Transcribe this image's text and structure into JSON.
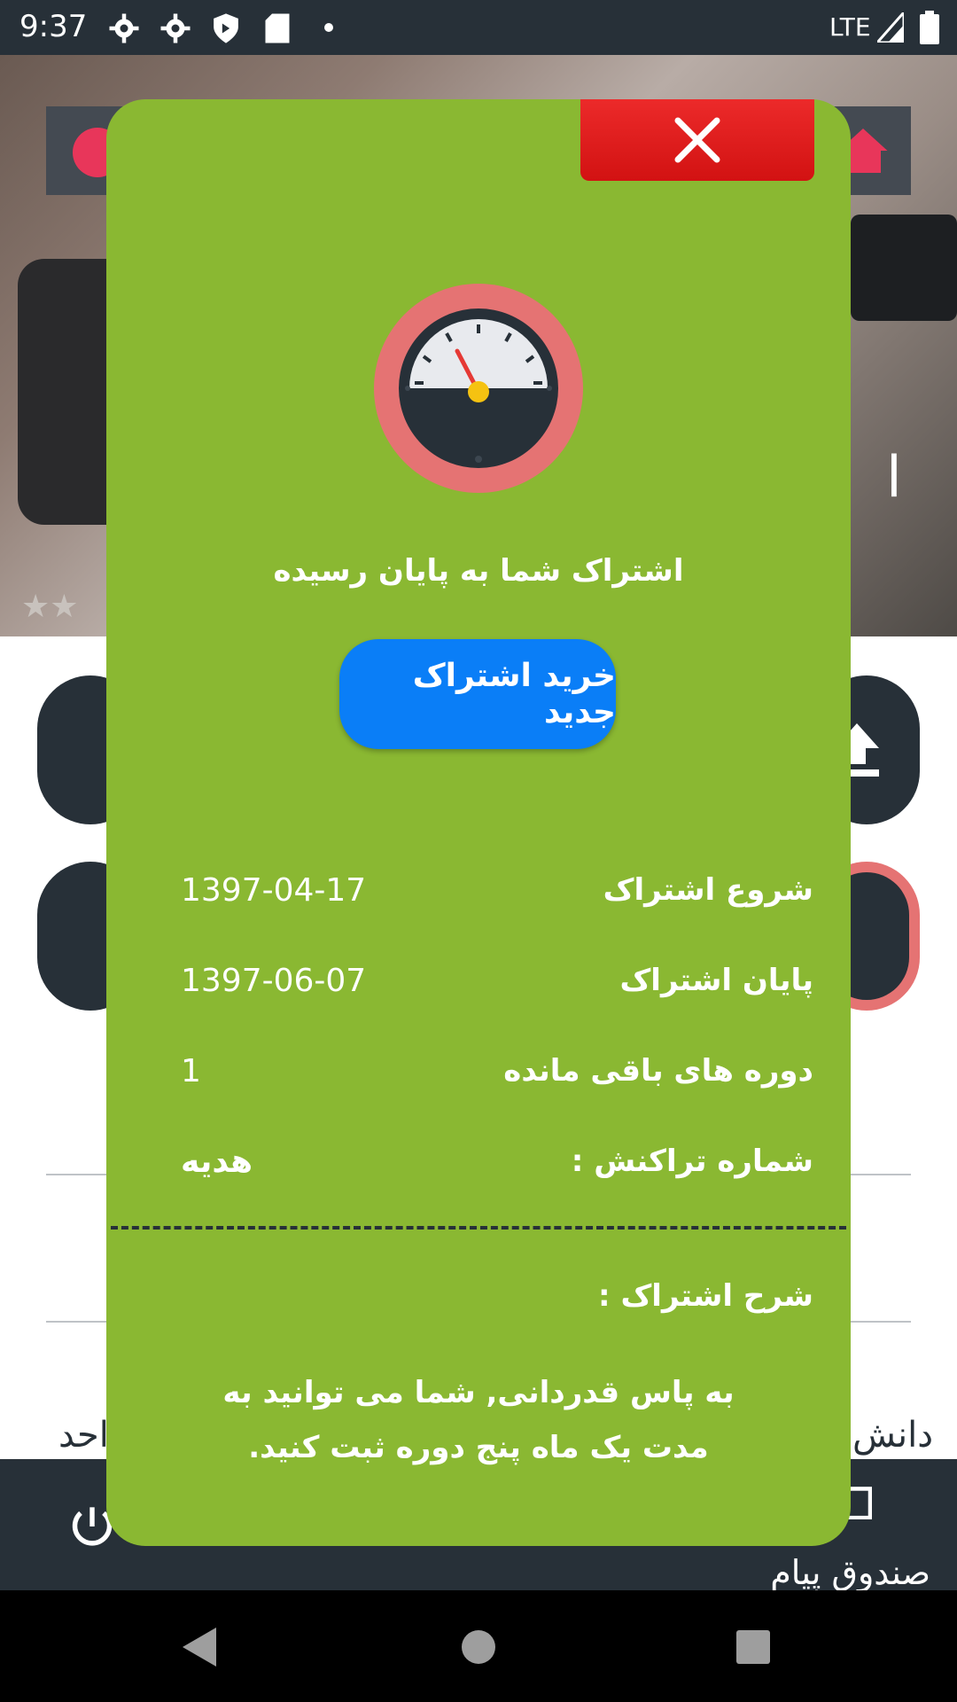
{
  "status_bar": {
    "time": "9:37",
    "network": "LTE",
    "icons": [
      "gear-icon",
      "gear-icon",
      "shield-icon",
      "sd-card-icon",
      "dot-icon",
      "signal-icon",
      "battery-icon"
    ]
  },
  "background": {
    "hero_partial_text": "ا",
    "left_partial_text": "احد",
    "right_partial_text": "دانش",
    "inbox_label": "صندوق پیام"
  },
  "dialog": {
    "status_message": "اشتراک شما به پایان رسیده",
    "buy_button_label": "خرید اشتراک جدید",
    "rows": [
      {
        "label": "شروع اشتراک",
        "value": "1397-04-17"
      },
      {
        "label": "پایان اشتراک",
        "value": "1397-06-07"
      },
      {
        "label": "دوره های باقی مانده",
        "value": "1"
      },
      {
        "label": "شماره تراکنش :",
        "value": "هدیه"
      }
    ],
    "description_title": "شرح اشتراک :",
    "description_body": "به پاس قدردانی, شما می توانید به مدت یک ماه پنج دوره ثبت کنید."
  },
  "colors": {
    "dialog_bg": "#8ab832",
    "close_bg": "#e01c1c",
    "buy_button": "#0a7ef7",
    "dark": "#273038"
  }
}
